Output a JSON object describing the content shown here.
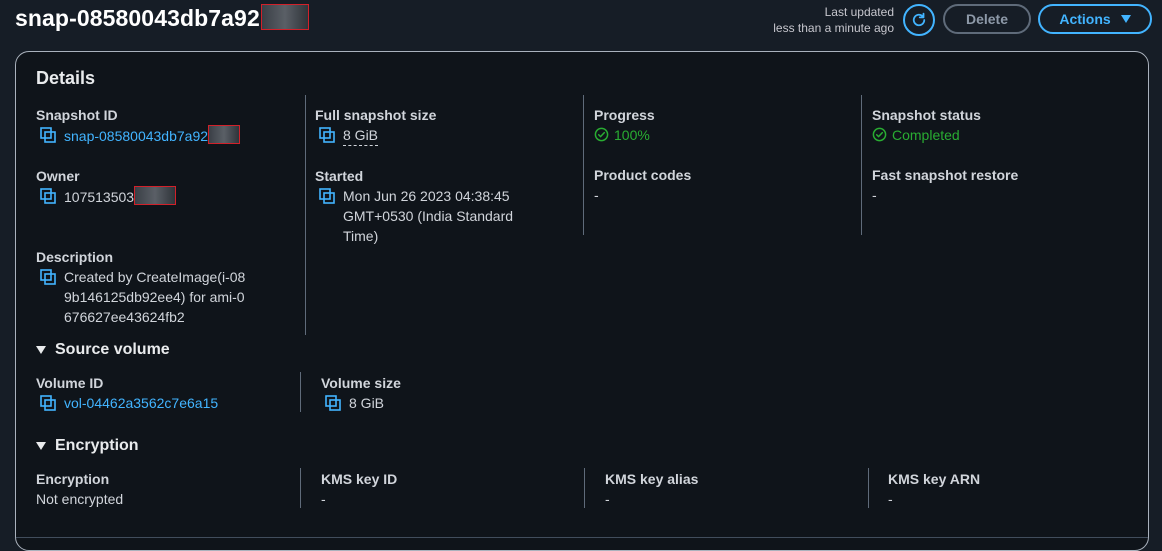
{
  "header": {
    "title": "snap-08580043db7a92",
    "last_updated_label": "Last updated",
    "last_updated_value": "less than a minute ago",
    "delete_label": "Delete",
    "actions_label": "Actions"
  },
  "details": {
    "title": "Details",
    "snapshot_id_label": "Snapshot ID",
    "snapshot_id_value": "snap-08580043db7a92",
    "owner_label": "Owner",
    "owner_value": "107513503",
    "description_label": "Description",
    "description_value": "Created by CreateImage(i-089b146125db92ee4) for ami-0676627ee43624fb2",
    "full_size_label": "Full snapshot size",
    "full_size_value": "8 GiB",
    "started_label": "Started",
    "started_value": "Mon Jun 26 2023 04:38:45 GMT+0530 (India Standard Time)",
    "progress_label": "Progress",
    "progress_value": "100%",
    "product_codes_label": "Product codes",
    "product_codes_value": "-",
    "status_label": "Snapshot status",
    "status_value": "Completed",
    "fast_restore_label": "Fast snapshot restore",
    "fast_restore_value": "-"
  },
  "source_volume": {
    "title": "Source volume",
    "volume_id_label": "Volume ID",
    "volume_id_value": "vol-04462a3562c7e6a15",
    "volume_size_label": "Volume size",
    "volume_size_value": "8 GiB"
  },
  "encryption": {
    "title": "Encryption",
    "encryption_label": "Encryption",
    "encryption_value": "Not encrypted",
    "kms_id_label": "KMS key ID",
    "kms_id_value": "-",
    "kms_alias_label": "KMS key alias",
    "kms_alias_value": "-",
    "kms_arn_label": "KMS key ARN",
    "kms_arn_value": "-"
  },
  "icons": {
    "refresh": "refresh-icon",
    "copy": "copy-icon",
    "status": "check-circle-icon",
    "expand": "caret-down-icon"
  },
  "colors": {
    "accent": "#42b4ff",
    "success": "#29ad32",
    "background": "#0f141a"
  }
}
